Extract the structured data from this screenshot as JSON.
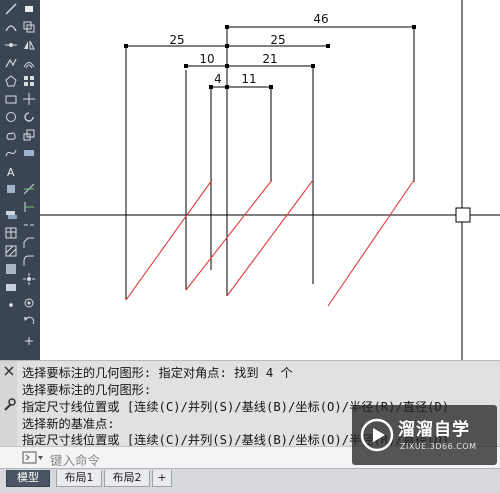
{
  "drawing": {
    "dimensions": {
      "d46": "46",
      "d25_left": "25",
      "d25_right": "25",
      "d10": "10",
      "d21": "21",
      "d4": "4",
      "d11": "11"
    }
  },
  "command_history": {
    "lines": [
      "选择要标注的几何图形: 指定对角点: 找到 4 个",
      "选择要标注的几何图形:",
      "指定尺寸线位置或 [连续(C)/并列(S)/基线(B)/坐标(O)/半径(R)/直径(D)",
      "选择新的基准点:",
      "指定尺寸线位置或 [连续(C)/并列(S)/基线(B)/坐标(O)/半径(R)/直径(D)"
    ]
  },
  "command_input": {
    "placeholder": "键入命令"
  },
  "layout_tabs": [
    {
      "label": "模型",
      "active": true
    },
    {
      "label": "布局1",
      "active": false
    },
    {
      "label": "布局2",
      "active": false
    },
    {
      "label": "+",
      "active": false
    }
  ],
  "watermark": {
    "name": "溜溜自学",
    "url": "ZIXUE.3D66.COM"
  },
  "colors": {
    "toolbar_bg": "#3b4452",
    "hatch_red": "#e23c3c",
    "history_bg": "#e1e1e1"
  }
}
